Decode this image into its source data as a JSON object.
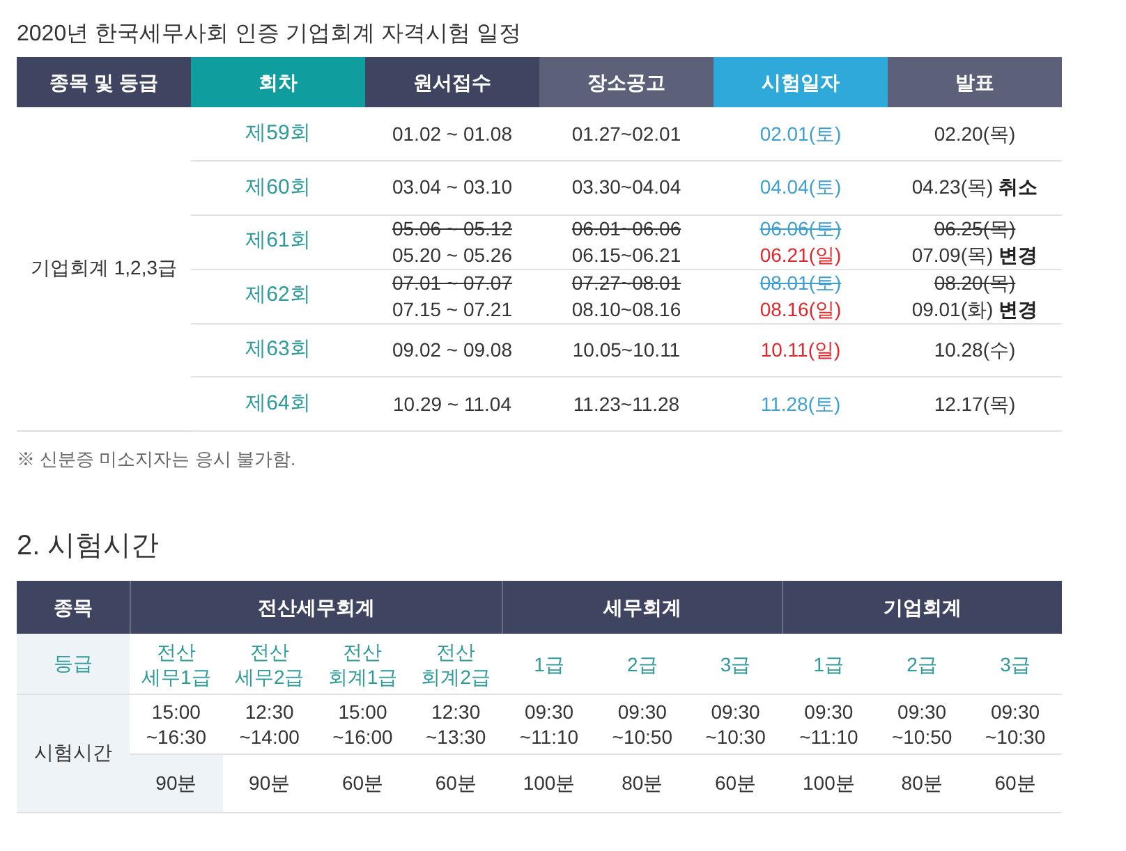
{
  "title": "2020년 한국세무사회 인증 기업회계 자격시험 일정",
  "schedule": {
    "columns": [
      "종목 및 등급",
      "회차",
      "원서접수",
      "장소공고",
      "시험일자",
      "발표"
    ],
    "category": "기업회계 1,2,3급",
    "rows": [
      {
        "round": "제59회",
        "application": [
          {
            "text": "01.02 ~ 01.08",
            "struck": false
          }
        ],
        "notice": [
          {
            "text": "01.27~02.01",
            "struck": false
          }
        ],
        "exam": [
          {
            "text": "02.01(토)",
            "struck": false,
            "color": "#3d9fcf"
          }
        ],
        "result": [
          {
            "text": "02.20(목)",
            "struck": false
          }
        ]
      },
      {
        "round": "제60회",
        "application": [
          {
            "text": "03.04 ~ 03.10",
            "struck": false
          }
        ],
        "notice": [
          {
            "text": "03.30~04.04",
            "struck": false
          }
        ],
        "exam": [
          {
            "text": "04.04(토)",
            "struck": false,
            "color": "#3d9fcf"
          }
        ],
        "result": [
          {
            "text": "04.23(목)",
            "struck": false,
            "note": "취소"
          }
        ]
      },
      {
        "round": "제61회",
        "application": [
          {
            "text": "05.06 ~ 05.12",
            "struck": true
          },
          {
            "text": "05.20 ~ 05.26",
            "struck": false
          }
        ],
        "notice": [
          {
            "text": "06.01~06.06",
            "struck": true
          },
          {
            "text": "06.15~06.21",
            "struck": false
          }
        ],
        "exam": [
          {
            "text": "06.06(토)",
            "struck": true,
            "color": "#3d9fcf"
          },
          {
            "text": "06.21(일)",
            "struck": false,
            "color": "#e0262a"
          }
        ],
        "result": [
          {
            "text": "06.25(목)",
            "struck": true
          },
          {
            "text": "07.09(목)",
            "struck": false,
            "note": "변경"
          }
        ]
      },
      {
        "round": "제62회",
        "application": [
          {
            "text": "07.01 ~ 07.07",
            "struck": true
          },
          {
            "text": "07.15 ~ 07.21",
            "struck": false
          }
        ],
        "notice": [
          {
            "text": "07.27~08.01",
            "struck": true
          },
          {
            "text": "08.10~08.16",
            "struck": false
          }
        ],
        "exam": [
          {
            "text": "08.01(토)",
            "struck": true,
            "color": "#3d9fcf"
          },
          {
            "text": "08.16(일)",
            "struck": false,
            "color": "#e0262a"
          }
        ],
        "result": [
          {
            "text": "08.20(목)",
            "struck": true
          },
          {
            "text": "09.01(화)",
            "struck": false,
            "note": "변경"
          }
        ]
      },
      {
        "round": "제63회",
        "application": [
          {
            "text": "09.02 ~ 09.08",
            "struck": false
          }
        ],
        "notice": [
          {
            "text": "10.05~10.11",
            "struck": false
          }
        ],
        "exam": [
          {
            "text": "10.11(일)",
            "struck": false,
            "color": "#e0262a"
          }
        ],
        "result": [
          {
            "text": "10.28(수)",
            "struck": false
          }
        ]
      },
      {
        "round": "제64회",
        "application": [
          {
            "text": "10.29 ~ 11.04",
            "struck": false
          }
        ],
        "notice": [
          {
            "text": "11.23~11.28",
            "struck": false
          }
        ],
        "exam": [
          {
            "text": "11.28(토)",
            "struck": false,
            "color": "#3d9fcf"
          }
        ],
        "result": [
          {
            "text": "12.17(목)",
            "struck": false
          }
        ]
      }
    ],
    "footnote": "※ 신분증 미소지자는 응시 불가함."
  },
  "section_heading": "2. 시험시간",
  "times": {
    "subject_label": "종목",
    "grade_label": "등급",
    "time_label": "시험시간",
    "subjects": [
      {
        "name": "전산세무회계",
        "levels": [
          {
            "grade": [
              "전산",
              "세무1급"
            ],
            "time": [
              "15:00",
              "~16:30"
            ],
            "duration": "90분"
          },
          {
            "grade": [
              "전산",
              "세무2급"
            ],
            "time": [
              "12:30",
              "~14:00"
            ],
            "duration": "90분"
          },
          {
            "grade": [
              "전산",
              "회계1급"
            ],
            "time": [
              "15:00",
              "~16:00"
            ],
            "duration": "60분"
          },
          {
            "grade": [
              "전산",
              "회계2급"
            ],
            "time": [
              "12:30",
              "~13:30"
            ],
            "duration": "60분"
          }
        ]
      },
      {
        "name": "세무회계",
        "levels": [
          {
            "grade": [
              "1급"
            ],
            "time": [
              "09:30",
              "~11:10"
            ],
            "duration": "100분"
          },
          {
            "grade": [
              "2급"
            ],
            "time": [
              "09:30",
              "~10:50"
            ],
            "duration": "80분"
          },
          {
            "grade": [
              "3급"
            ],
            "time": [
              "09:30",
              "~10:30"
            ],
            "duration": "60분"
          }
        ]
      },
      {
        "name": "기업회계",
        "levels": [
          {
            "grade": [
              "1급"
            ],
            "time": [
              "09:30",
              "~11:10"
            ],
            "duration": "100분"
          },
          {
            "grade": [
              "2급"
            ],
            "time": [
              "09:30",
              "~10:50"
            ],
            "duration": "80분"
          },
          {
            "grade": [
              "3급"
            ],
            "time": [
              "09:30",
              "~10:30"
            ],
            "duration": "60분"
          }
        ]
      }
    ]
  }
}
